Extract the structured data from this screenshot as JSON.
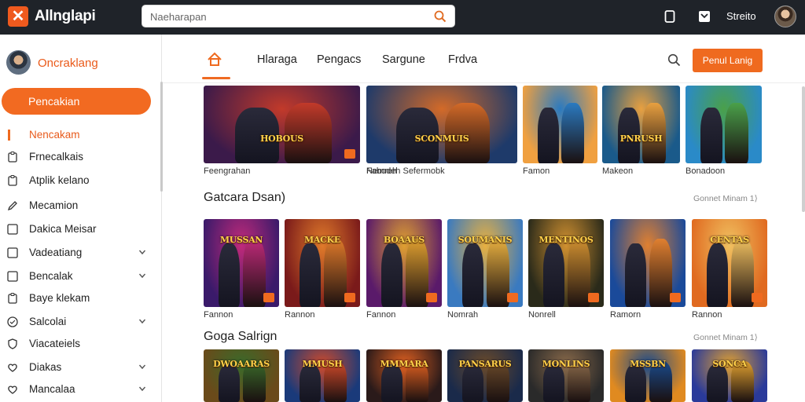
{
  "header": {
    "app_title": "Allnglapi",
    "search_placeholder": "Naeharapan",
    "user_name": "Streito"
  },
  "sidebar": {
    "profile_name": "Oncraklang",
    "primary_button": "Pencakian",
    "items": [
      {
        "label": "Nencakam",
        "icon": "square-icon",
        "active": true,
        "chevron": false
      },
      {
        "label": "Frnecalkais",
        "icon": "clipboard-icon",
        "active": false,
        "chevron": false
      },
      {
        "label": "Atplik kelano",
        "icon": "clipboard-icon",
        "active": false,
        "chevron": false
      },
      {
        "label": "Mecamion",
        "icon": "pencil-icon",
        "active": false,
        "chevron": false
      },
      {
        "label": "Dakica Meisar",
        "icon": "square-icon",
        "active": false,
        "chevron": false
      },
      {
        "label": "Vadeatiang",
        "icon": "square-icon",
        "active": false,
        "chevron": true
      },
      {
        "label": "Bencalak",
        "icon": "square-icon",
        "active": false,
        "chevron": true
      },
      {
        "label": "Baye klekam",
        "icon": "clipboard-icon",
        "active": false,
        "chevron": false
      },
      {
        "label": "Salcolai",
        "icon": "circle-icon",
        "active": false,
        "chevron": true
      },
      {
        "label": "Viacateiels",
        "icon": "shield-icon",
        "active": false,
        "chevron": false
      },
      {
        "label": "Diakas",
        "icon": "heart-icon",
        "active": false,
        "chevron": true
      },
      {
        "label": "Mancalaa",
        "icon": "heart-icon",
        "active": false,
        "chevron": true
      }
    ]
  },
  "tabs": {
    "home_icon": "home-icon",
    "items": [
      "Hlaraga",
      "Pengacs",
      "Sargune",
      "Frdva"
    ],
    "cta_label": "Penul Lanig"
  },
  "sections": [
    {
      "title": "",
      "more": "",
      "cards": [
        {
          "title": "HOBOUS",
          "caption": "Feengrahan",
          "bg": [
            "#3b1a4a",
            "#c23a2a"
          ]
        },
        {
          "title": "SCONMUIS",
          "caption": "Nemreh",
          "bg": [
            "#1e3a6a",
            "#d36a28"
          ]
        },
        {
          "title": "",
          "caption": "Famon",
          "bg": [
            "#f0a040",
            "#2b7ac0"
          ]
        },
        {
          "title": "PNRUSH",
          "caption": "Makeon",
          "bg": [
            "#1a5a8a",
            "#e8a040"
          ]
        },
        {
          "title": "",
          "caption": "Bonadoon",
          "bg": [
            "#2a8ac8",
            "#4aa04a"
          ]
        }
      ],
      "extra_caption": "Fabodeh Sefermobk"
    },
    {
      "title": "Gatcara Dsan)",
      "more": "Gonnet Minam 1⟩",
      "cards": [
        {
          "title": "MUSSAN",
          "caption": "Fannon",
          "bg": [
            "#3a1a6a",
            "#c02a7a"
          ]
        },
        {
          "title": "MACKE",
          "caption": "Rannon",
          "bg": [
            "#7a1a1a",
            "#e07a2a"
          ]
        },
        {
          "title": "BOAAUS",
          "caption": "Fannon",
          "bg": [
            "#5a1a6a",
            "#e0a030"
          ]
        },
        {
          "title": "SOUMANIS",
          "caption": "Nomrah",
          "bg": [
            "#3a7ac0",
            "#e8b040"
          ]
        },
        {
          "title": "MENTINOS",
          "caption": "Nonrell",
          "bg": [
            "#2a2a1a",
            "#d09030"
          ]
        },
        {
          "title": "",
          "caption": "Ramorn",
          "bg": [
            "#1a4a9a",
            "#e08030"
          ]
        },
        {
          "title": "CENTAS",
          "caption": "Rannon",
          "bg": [
            "#e06a20",
            "#f0c060"
          ]
        }
      ]
    },
    {
      "title": "Goga Salrign",
      "more": "Gonnet Minam 1⟩",
      "cards": [
        {
          "title": "DWOAARAS",
          "bg": [
            "#6a4a1a",
            "#3a6a2a"
          ]
        },
        {
          "title": "MMUSH",
          "bg": [
            "#1a3a7a",
            "#d04a2a"
          ]
        },
        {
          "title": "MMMARA",
          "bg": [
            "#2a1a1a",
            "#e06020"
          ]
        },
        {
          "title": "PANSARUS",
          "bg": [
            "#1a2a4a",
            "#6a4a2a"
          ]
        },
        {
          "title": "MONLINS",
          "bg": [
            "#2a2a2a",
            "#8a6a4a"
          ]
        },
        {
          "title": "MSSBN",
          "bg": [
            "#e08a20",
            "#1a4a8a"
          ]
        },
        {
          "title": "SONCA",
          "bg": [
            "#2a3a9a",
            "#e0a030"
          ]
        }
      ]
    }
  ],
  "colors": {
    "accent": "#ef6a1f",
    "topbar": "#1f2329"
  }
}
